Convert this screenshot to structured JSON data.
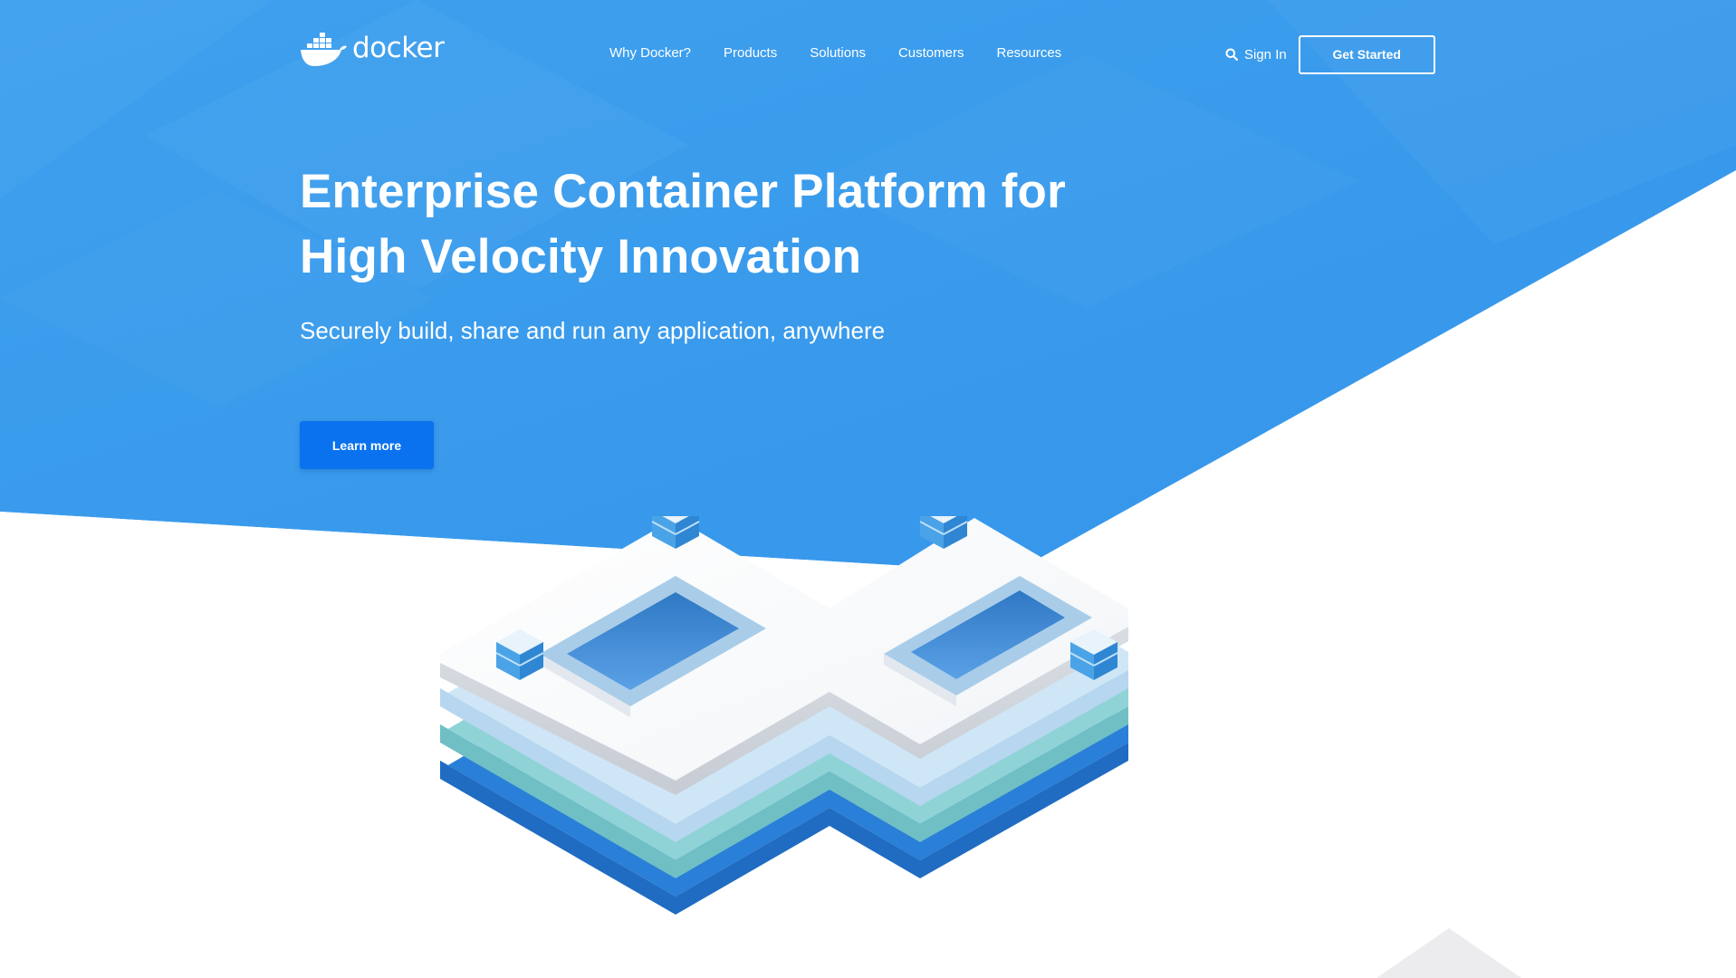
{
  "brand": {
    "logo_text": "docker",
    "logo_icon": "docker-whale-icon",
    "colors": {
      "hero_blue": "#3a9bec",
      "button_blue": "#0a72ef",
      "white": "#ffffff"
    }
  },
  "nav": {
    "links": [
      {
        "label": "Why Docker?"
      },
      {
        "label": "Products"
      },
      {
        "label": "Solutions"
      },
      {
        "label": "Customers"
      },
      {
        "label": "Resources"
      }
    ],
    "search_icon": "search-icon",
    "sign_in_label": "Sign In",
    "get_started_label": "Get Started"
  },
  "hero": {
    "title_line1": "Enterprise Container Platform for",
    "title_line2": "High Velocity Innovation",
    "subtitle": "Securely build, share and run any application, anywhere",
    "cta_label": "Learn more"
  },
  "illustration": {
    "icon": "infinity-platform-icon",
    "container_icon": "container-stack-icon"
  }
}
